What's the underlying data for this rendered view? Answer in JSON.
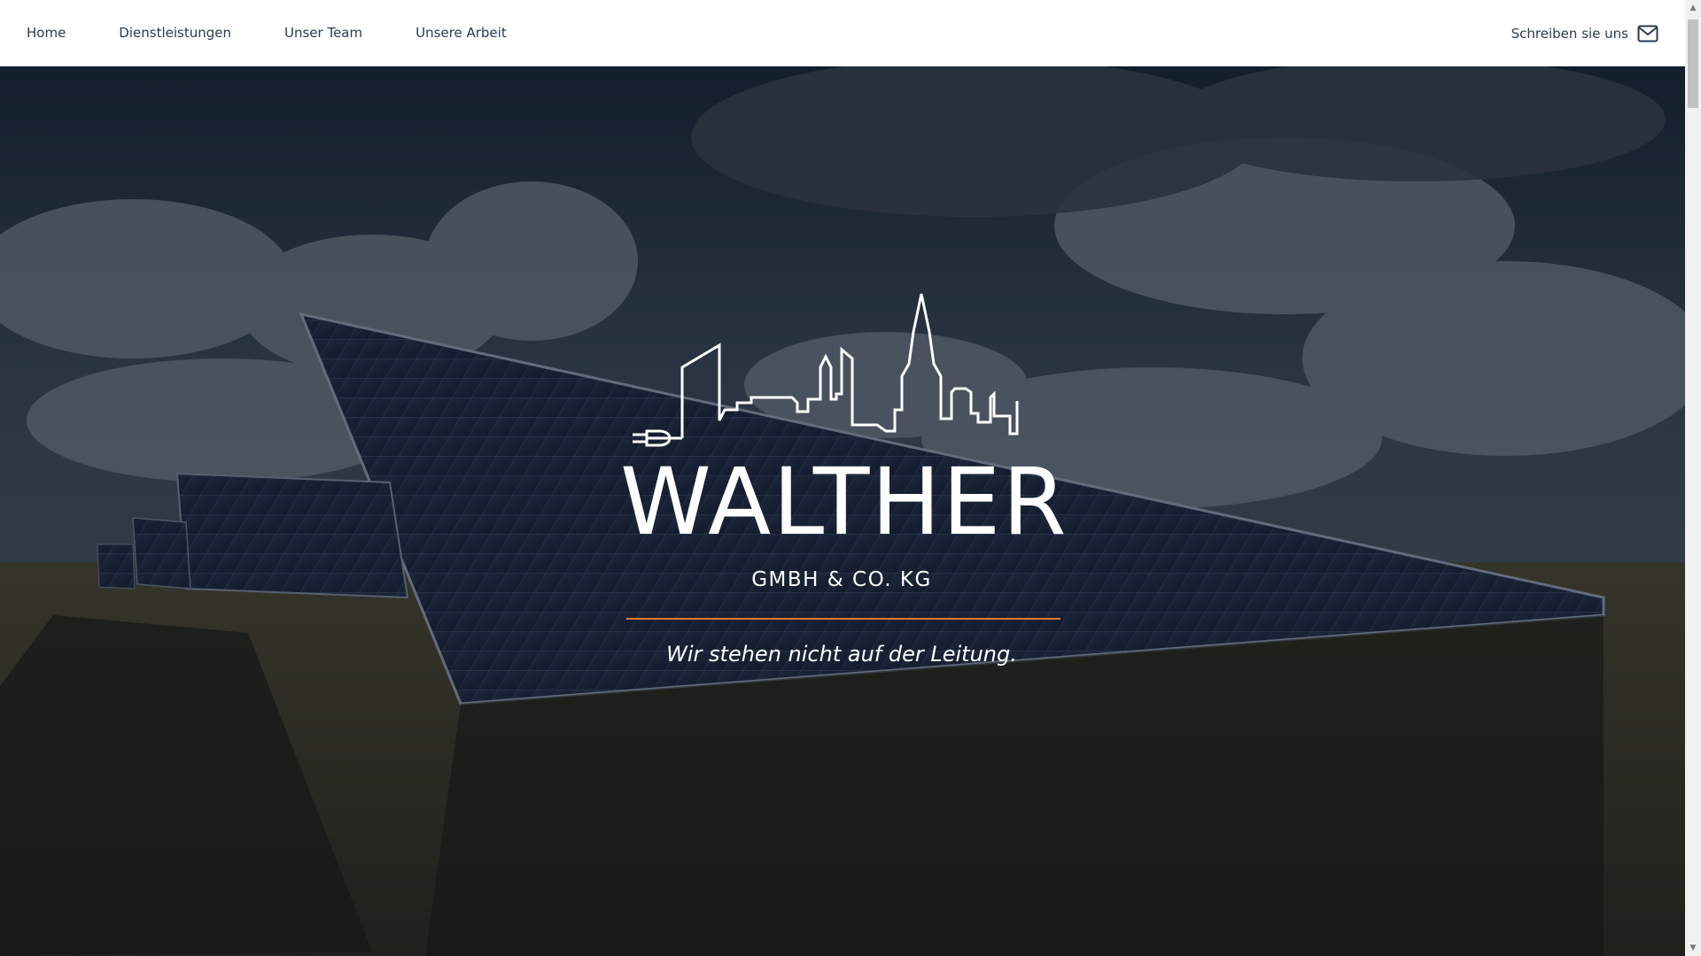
{
  "nav": {
    "items": [
      {
        "label": "Home"
      },
      {
        "label": "Dienstleistungen"
      },
      {
        "label": "Unser Team"
      },
      {
        "label": "Unsere Arbeit"
      }
    ],
    "contact_label": "Schreiben sie uns",
    "contact_icon": "mail-icon"
  },
  "hero": {
    "logo_icon": "city-skyline-plug-icon",
    "company_name": "WALTHER",
    "company_suffix": "GMBH & CO. KG",
    "tagline": "Wir stehen nicht auf der Leitung.",
    "background_image": "solar-panel-field-photo"
  },
  "colors": {
    "nav_text": "#2a3a55",
    "accent_rule": "#e07b2e",
    "hero_text": "#ffffff"
  }
}
